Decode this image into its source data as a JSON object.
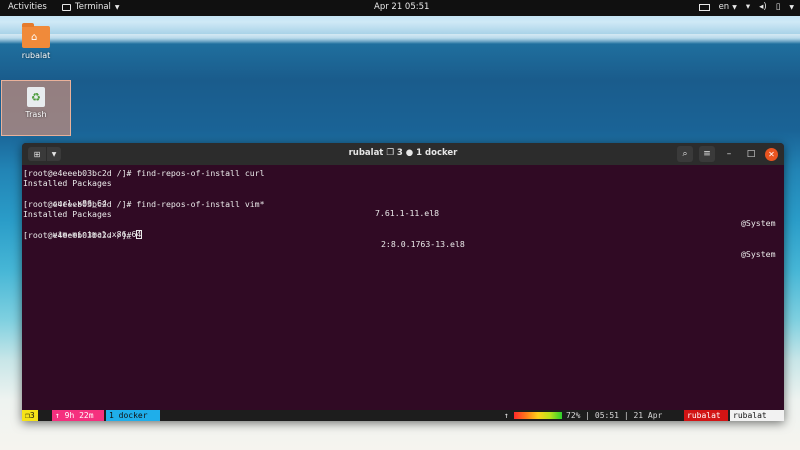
{
  "topbar": {
    "activities": "Activities",
    "app_name": "Terminal",
    "clock": "Apr 21  05:51",
    "language": "en"
  },
  "desktop": {
    "icons": [
      {
        "label": "rubalat",
        "icon": "home-folder-icon"
      },
      {
        "label": "Trash",
        "icon": "trash-icon"
      }
    ]
  },
  "window": {
    "title": "rubalat ❐ 3 ● 1 docker"
  },
  "terminal": {
    "lines": [
      {
        "text": "[root@e4eeeb03bc2d /]# find-repos-of-install curl"
      },
      {
        "text": "Installed Packages"
      },
      {
        "name": "curl.x86_64",
        "version": "7.61.1-11.el8",
        "repo": "@System"
      },
      {
        "text": "[root@e4eeeb03bc2d /]# find-repos-of-install vim*"
      },
      {
        "text": "Installed Packages"
      },
      {
        "name": "vim-minimal.x86_64",
        "version": "2:8.0.1763-13.el8",
        "repo": "@System"
      },
      {
        "text": "[root@e4eeeb03bc2d /]# "
      }
    ]
  },
  "statusbar": {
    "window_index": "❐3",
    "uptime": "↑ 9h 22m",
    "session": "1 docker",
    "up_arrow": "↑",
    "battery_percent": 72,
    "battery_text": "72%",
    "info": "| 05:51 | 21 Apr",
    "host_user": "rubalat",
    "host_name": "rubalat"
  }
}
